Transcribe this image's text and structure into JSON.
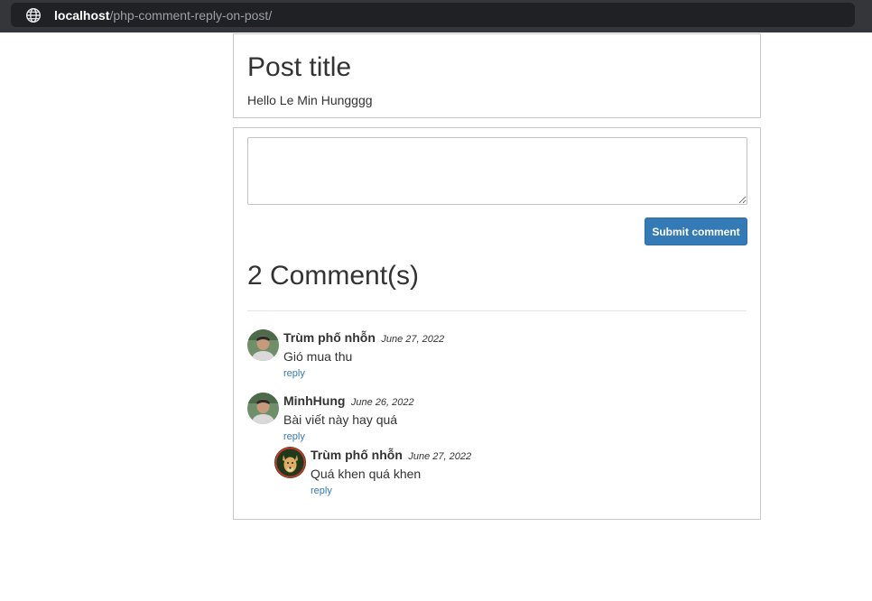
{
  "browser": {
    "url_host": "localhost",
    "url_path": "/php-comment-reply-on-post/"
  },
  "post": {
    "title": "Post title",
    "body": "Hello Le Min Hungggg"
  },
  "comment_form": {
    "textarea_value": "",
    "submit_label": "Submit comment"
  },
  "comments_heading": "2 Comment(s)",
  "comments": [
    {
      "author": "Trùm phố nhỗn",
      "date": "June 27, 2022",
      "text": "Gió mua thu",
      "reply_label": "reply",
      "avatar": "man-photo-avatar"
    },
    {
      "author": "MinhHung",
      "date": "June 26, 2022",
      "text": "Bài viết này hay quá",
      "reply_label": "reply",
      "avatar": "man-photo-avatar",
      "replies": [
        {
          "author": "Trùm phố nhỗn",
          "date": "June 27, 2022",
          "text": "Quá khen quá khen",
          "reply_label": "reply",
          "avatar": "dog-photo-avatar"
        }
      ]
    }
  ]
}
